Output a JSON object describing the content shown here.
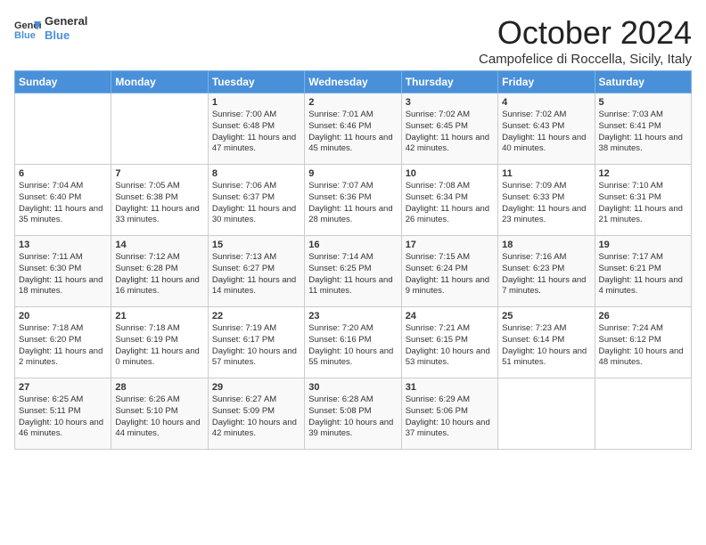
{
  "header": {
    "logo_general": "General",
    "logo_blue": "Blue",
    "month_title": "October 2024",
    "location": "Campofelice di Roccella, Sicily, Italy"
  },
  "days_of_week": [
    "Sunday",
    "Monday",
    "Tuesday",
    "Wednesday",
    "Thursday",
    "Friday",
    "Saturday"
  ],
  "weeks": [
    [
      {
        "day": "",
        "info": ""
      },
      {
        "day": "",
        "info": ""
      },
      {
        "day": "1",
        "info": "Sunrise: 7:00 AM\nSunset: 6:48 PM\nDaylight: 11 hours and 47 minutes."
      },
      {
        "day": "2",
        "info": "Sunrise: 7:01 AM\nSunset: 6:46 PM\nDaylight: 11 hours and 45 minutes."
      },
      {
        "day": "3",
        "info": "Sunrise: 7:02 AM\nSunset: 6:45 PM\nDaylight: 11 hours and 42 minutes."
      },
      {
        "day": "4",
        "info": "Sunrise: 7:02 AM\nSunset: 6:43 PM\nDaylight: 11 hours and 40 minutes."
      },
      {
        "day": "5",
        "info": "Sunrise: 7:03 AM\nSunset: 6:41 PM\nDaylight: 11 hours and 38 minutes."
      }
    ],
    [
      {
        "day": "6",
        "info": "Sunrise: 7:04 AM\nSunset: 6:40 PM\nDaylight: 11 hours and 35 minutes."
      },
      {
        "day": "7",
        "info": "Sunrise: 7:05 AM\nSunset: 6:38 PM\nDaylight: 11 hours and 33 minutes."
      },
      {
        "day": "8",
        "info": "Sunrise: 7:06 AM\nSunset: 6:37 PM\nDaylight: 11 hours and 30 minutes."
      },
      {
        "day": "9",
        "info": "Sunrise: 7:07 AM\nSunset: 6:36 PM\nDaylight: 11 hours and 28 minutes."
      },
      {
        "day": "10",
        "info": "Sunrise: 7:08 AM\nSunset: 6:34 PM\nDaylight: 11 hours and 26 minutes."
      },
      {
        "day": "11",
        "info": "Sunrise: 7:09 AM\nSunset: 6:33 PM\nDaylight: 11 hours and 23 minutes."
      },
      {
        "day": "12",
        "info": "Sunrise: 7:10 AM\nSunset: 6:31 PM\nDaylight: 11 hours and 21 minutes."
      }
    ],
    [
      {
        "day": "13",
        "info": "Sunrise: 7:11 AM\nSunset: 6:30 PM\nDaylight: 11 hours and 18 minutes."
      },
      {
        "day": "14",
        "info": "Sunrise: 7:12 AM\nSunset: 6:28 PM\nDaylight: 11 hours and 16 minutes."
      },
      {
        "day": "15",
        "info": "Sunrise: 7:13 AM\nSunset: 6:27 PM\nDaylight: 11 hours and 14 minutes."
      },
      {
        "day": "16",
        "info": "Sunrise: 7:14 AM\nSunset: 6:25 PM\nDaylight: 11 hours and 11 minutes."
      },
      {
        "day": "17",
        "info": "Sunrise: 7:15 AM\nSunset: 6:24 PM\nDaylight: 11 hours and 9 minutes."
      },
      {
        "day": "18",
        "info": "Sunrise: 7:16 AM\nSunset: 6:23 PM\nDaylight: 11 hours and 7 minutes."
      },
      {
        "day": "19",
        "info": "Sunrise: 7:17 AM\nSunset: 6:21 PM\nDaylight: 11 hours and 4 minutes."
      }
    ],
    [
      {
        "day": "20",
        "info": "Sunrise: 7:18 AM\nSunset: 6:20 PM\nDaylight: 11 hours and 2 minutes."
      },
      {
        "day": "21",
        "info": "Sunrise: 7:18 AM\nSunset: 6:19 PM\nDaylight: 11 hours and 0 minutes."
      },
      {
        "day": "22",
        "info": "Sunrise: 7:19 AM\nSunset: 6:17 PM\nDaylight: 10 hours and 57 minutes."
      },
      {
        "day": "23",
        "info": "Sunrise: 7:20 AM\nSunset: 6:16 PM\nDaylight: 10 hours and 55 minutes."
      },
      {
        "day": "24",
        "info": "Sunrise: 7:21 AM\nSunset: 6:15 PM\nDaylight: 10 hours and 53 minutes."
      },
      {
        "day": "25",
        "info": "Sunrise: 7:23 AM\nSunset: 6:14 PM\nDaylight: 10 hours and 51 minutes."
      },
      {
        "day": "26",
        "info": "Sunrise: 7:24 AM\nSunset: 6:12 PM\nDaylight: 10 hours and 48 minutes."
      }
    ],
    [
      {
        "day": "27",
        "info": "Sunrise: 6:25 AM\nSunset: 5:11 PM\nDaylight: 10 hours and 46 minutes."
      },
      {
        "day": "28",
        "info": "Sunrise: 6:26 AM\nSunset: 5:10 PM\nDaylight: 10 hours and 44 minutes."
      },
      {
        "day": "29",
        "info": "Sunrise: 6:27 AM\nSunset: 5:09 PM\nDaylight: 10 hours and 42 minutes."
      },
      {
        "day": "30",
        "info": "Sunrise: 6:28 AM\nSunset: 5:08 PM\nDaylight: 10 hours and 39 minutes."
      },
      {
        "day": "31",
        "info": "Sunrise: 6:29 AM\nSunset: 5:06 PM\nDaylight: 10 hours and 37 minutes."
      },
      {
        "day": "",
        "info": ""
      },
      {
        "day": "",
        "info": ""
      }
    ]
  ]
}
